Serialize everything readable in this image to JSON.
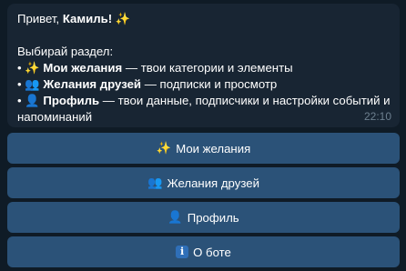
{
  "message": {
    "greeting_prefix": "Привет, ",
    "greeting_name": "Камиль!",
    "greeting_emoji": "✨",
    "prompt": "Выбирай раздел:",
    "items": [
      {
        "bullet": "•",
        "emoji": "✨",
        "title": "Мои желания",
        "description": " — твои категории и элементы"
      },
      {
        "bullet": "•",
        "emoji": "👥",
        "title": "Желания друзей",
        "description": " — подписки и просмотр"
      },
      {
        "bullet": "•",
        "emoji": "👤",
        "title": "Профиль",
        "description": " — твои данные, подписчики и настройки событий и напоминаний"
      }
    ],
    "time": "22:10"
  },
  "keyboard": {
    "buttons": [
      {
        "emoji": "✨",
        "label": "Мои желания"
      },
      {
        "emoji": "👥",
        "label": "Желания друзей"
      },
      {
        "emoji": "👤",
        "label": "Профиль"
      },
      {
        "icon": "info-icon",
        "icon_glyph": "i",
        "label": "О боте"
      }
    ]
  },
  "colors": {
    "background": "#0f1b26",
    "bubble": "#182533",
    "button": "#2b5278",
    "time": "#6d7f8f"
  }
}
